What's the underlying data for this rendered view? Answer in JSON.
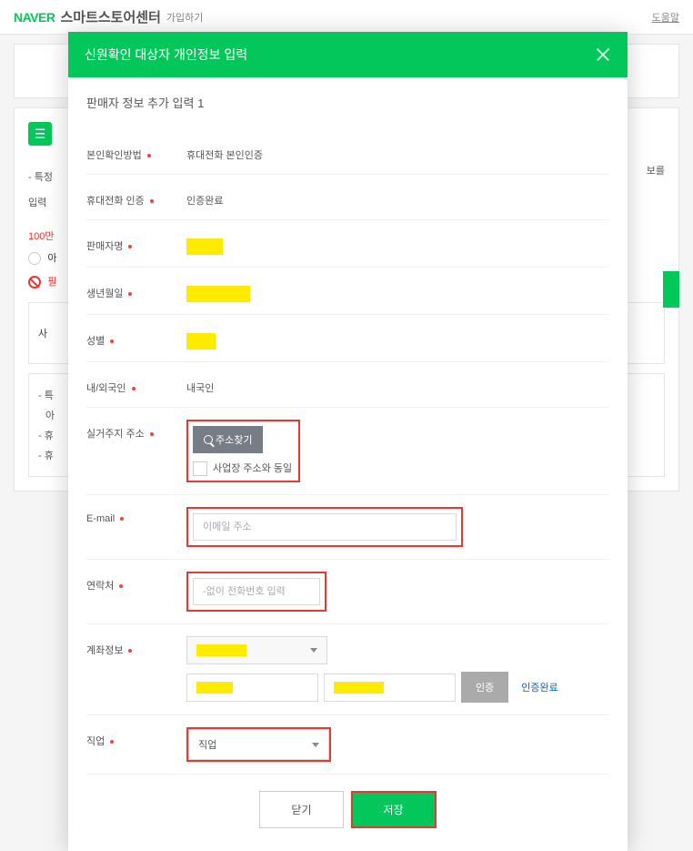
{
  "header": {
    "logo": "NAVER",
    "title": "스마트스토어센터",
    "signup": "가입하기",
    "help": "도움말"
  },
  "bg": {
    "trunc_desc_right": "보를",
    "trunc_bullet1_prefix": "- 특정",
    "trunc_bullet2_prefix": "입력",
    "red_label": "100만",
    "radio_label": "아",
    "prohibit_label": "필",
    "left_label_trunc": "사",
    "list_t": "- 특",
    "list_a": "아",
    "list_h1": "- 휴",
    "list_h2": "- 휴"
  },
  "modal": {
    "title": "신원확인 대상자 개인정보 입력",
    "subtitle": "판매자 정보 추가 입력 1",
    "labels": {
      "verify_method": "본인확인방법",
      "phone_cert": "휴대전화 인증",
      "seller_name": "판매자명",
      "birth": "생년월일",
      "gender": "성별",
      "nationality": "내/외국인",
      "address": "실거주지 주소",
      "email": "E-mail",
      "contact": "연락처",
      "account": "계좌정보",
      "job": "직업"
    },
    "values": {
      "verify_method": "휴대전화 본인인증",
      "phone_cert": "인증완료",
      "nationality": "내국인"
    },
    "address": {
      "find_btn": "주소찾기",
      "same_as_biz": "사업장 주소와 동일"
    },
    "email": {
      "placeholder": "이메일 주소"
    },
    "contact": {
      "placeholder": "-없이 전화번호 입력"
    },
    "account": {
      "cert_btn": "인증",
      "cert_done": "인증완료"
    },
    "job": {
      "select_label": "직업"
    },
    "footer": {
      "close": "닫기",
      "save": "저장"
    }
  }
}
